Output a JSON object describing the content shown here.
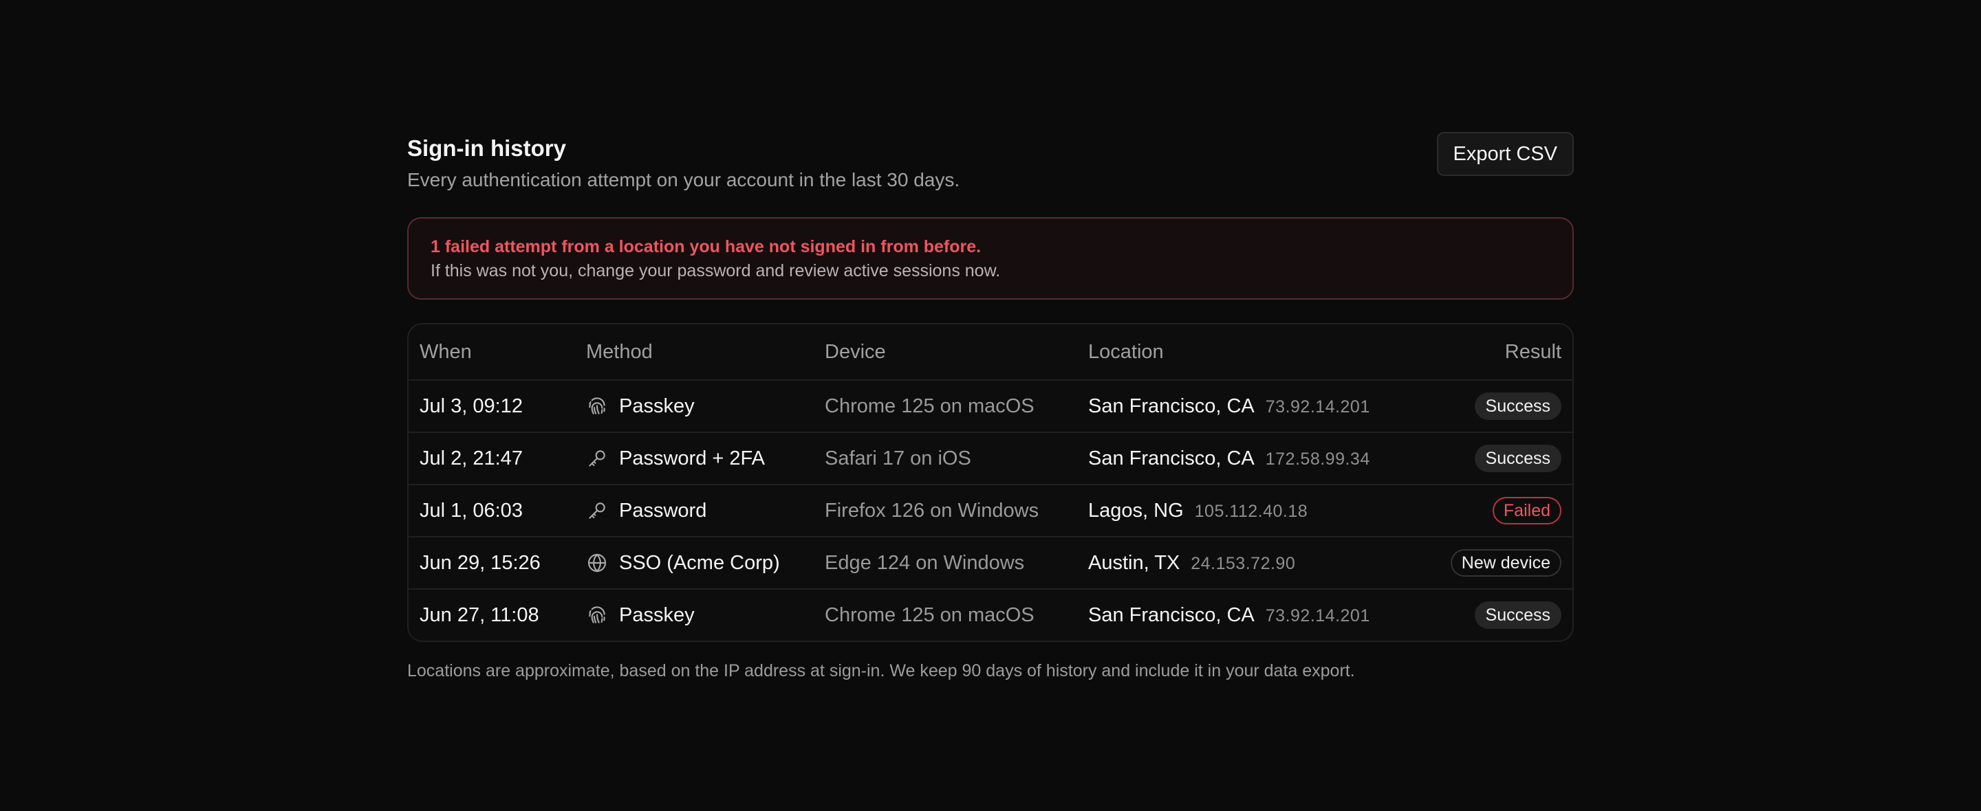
{
  "header": {
    "title": "Sign-in history",
    "subtitle": "Every authentication attempt on your account in the last 30 days.",
    "export_label": "Export CSV"
  },
  "alert": {
    "title": "1 failed attempt from a location you have not signed in from before.",
    "body": "If this was not you, change your password and review active sessions now."
  },
  "table": {
    "columns": {
      "when": "When",
      "method": "Method",
      "device": "Device",
      "location": "Location",
      "result": "Result"
    },
    "rows": [
      {
        "when": "Jul 3, 09:12",
        "method": "Passkey",
        "method_icon": "fingerprint-icon",
        "device": "Chrome 125 on macOS",
        "city": "San Francisco, CA",
        "ip": "73.92.14.201",
        "result": "Success",
        "result_kind": "success"
      },
      {
        "when": "Jul 2, 21:47",
        "method": "Password + 2FA",
        "method_icon": "key-icon",
        "device": "Safari 17 on iOS",
        "city": "San Francisco, CA",
        "ip": "172.58.99.34",
        "result": "Success",
        "result_kind": "success"
      },
      {
        "when": "Jul 1, 06:03",
        "method": "Password",
        "method_icon": "key-icon",
        "device": "Firefox 126 on Windows",
        "city": "Lagos, NG",
        "ip": "105.112.40.18",
        "result": "Failed",
        "result_kind": "failed"
      },
      {
        "when": "Jun 29, 15:26",
        "method": "SSO (Acme Corp)",
        "method_icon": "globe-icon",
        "device": "Edge 124 on Windows",
        "city": "Austin, TX",
        "ip": "24.153.72.90",
        "result": "New device",
        "result_kind": "newdev"
      },
      {
        "when": "Jun 27, 11:08",
        "method": "Passkey",
        "method_icon": "fingerprint-icon",
        "device": "Chrome 125 on macOS",
        "city": "San Francisco, CA",
        "ip": "73.92.14.201",
        "result": "Success",
        "result_kind": "success"
      }
    ]
  },
  "footnote": "Locations are approximate, based on the IP address at sign-in. We keep 90 days of history and include it in your data export.",
  "colors": {
    "background": "#0b0b0b",
    "danger": "#f0555e",
    "muted": "#a3a3a3"
  }
}
